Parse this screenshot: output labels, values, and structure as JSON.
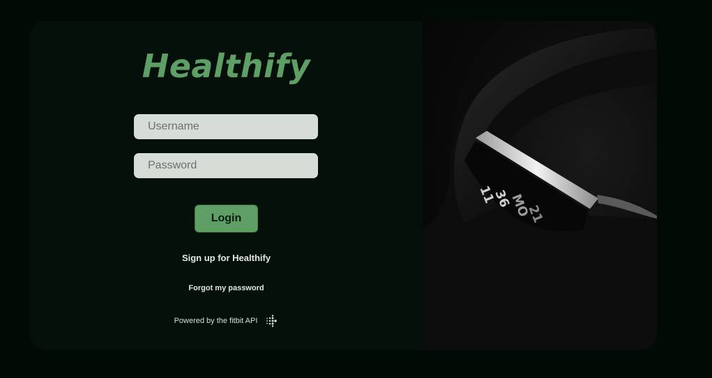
{
  "app": {
    "brand": "Healthify"
  },
  "form": {
    "username_placeholder": "Username",
    "username_value": "",
    "password_placeholder": "Password",
    "password_value": "",
    "login_label": "Login"
  },
  "links": {
    "signup": "Sign up for Healthify",
    "forgot": "Forgot my password"
  },
  "footer": {
    "powered_by": "Powered by the fitbit API",
    "logo_icon": "fitbit-logo-icon"
  },
  "hero": {
    "image": "fitbit-wristband-photo",
    "watch_time_hours": "11",
    "watch_time_minutes": "36",
    "watch_day": "MO",
    "watch_date": "21"
  },
  "colors": {
    "page_bg": "#020a06",
    "panel_bg": "#041009",
    "brand_green": "#5e9f66",
    "field_bg": "#d6ddd7"
  }
}
